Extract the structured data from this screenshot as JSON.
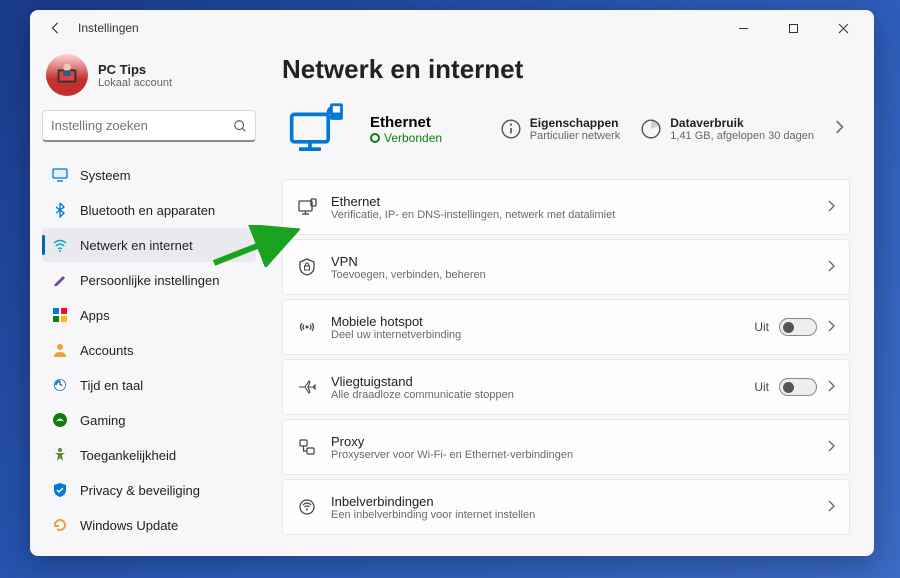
{
  "window": {
    "title": "Instellingen"
  },
  "profile": {
    "name": "PC Tips",
    "sub": "Lokaal account"
  },
  "search": {
    "placeholder": "Instelling zoeken"
  },
  "sidebar": {
    "items": [
      {
        "label": "Systeem"
      },
      {
        "label": "Bluetooth en apparaten"
      },
      {
        "label": "Netwerk en internet"
      },
      {
        "label": "Persoonlijke instellingen"
      },
      {
        "label": "Apps"
      },
      {
        "label": "Accounts"
      },
      {
        "label": "Tijd en taal"
      },
      {
        "label": "Gaming"
      },
      {
        "label": "Toegankelijkheid"
      },
      {
        "label": "Privacy & beveiliging"
      },
      {
        "label": "Windows Update"
      }
    ]
  },
  "page": {
    "title": "Netwerk en internet"
  },
  "hero": {
    "name": "Ethernet",
    "status": "Verbonden",
    "props": {
      "label": "Eigenschappen",
      "sub": "Particulier netwerk"
    },
    "data": {
      "label": "Dataverbruik",
      "sub": "1,41 GB, afgelopen 30 dagen"
    }
  },
  "cards": [
    {
      "title": "Ethernet",
      "sub": "Verificatie, IP- en DNS-instellingen, netwerk met datalimiet",
      "toggle": null
    },
    {
      "title": "VPN",
      "sub": "Toevoegen, verbinden, beheren",
      "toggle": null
    },
    {
      "title": "Mobiele hotspot",
      "sub": "Deel uw internetverbinding",
      "toggle": "Uit"
    },
    {
      "title": "Vliegtuigstand",
      "sub": "Alle draadloze communicatie stoppen",
      "toggle": "Uit"
    },
    {
      "title": "Proxy",
      "sub": "Proxyserver voor Wi-Fi- en Ethernet-verbindingen",
      "toggle": null
    },
    {
      "title": "Inbelverbindingen",
      "sub": "Een inbelverbinding voor internet instellen",
      "toggle": null
    }
  ]
}
